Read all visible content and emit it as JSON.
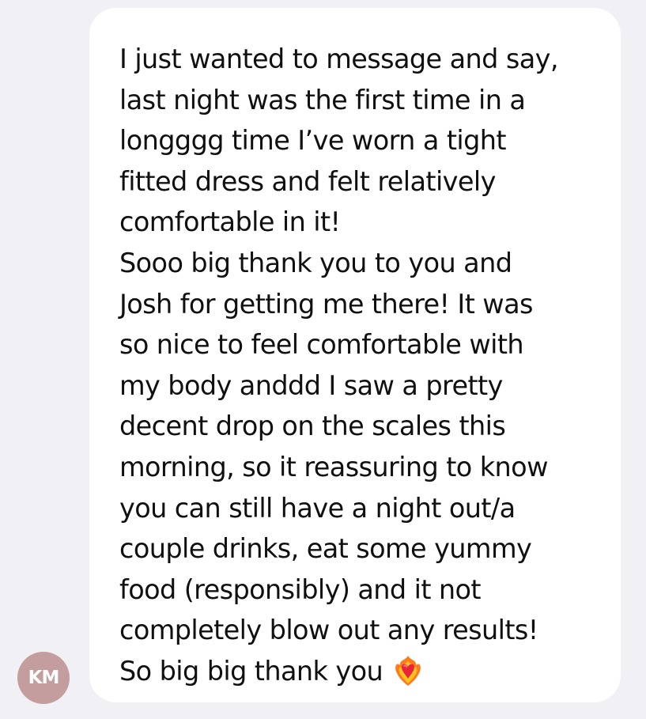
{
  "conversation": {
    "message": {
      "text": "I just wanted to message and say,\nlast night was the first time in a\nlongggg time I’ve worn a tight\nfitted dress and felt relatively\ncomfortable in it!\nSooo big thank you to you and\nJosh for getting me there! It was\nso nice to feel comfortable with\nmy body anddd I saw a pretty\ndecent drop on the scales this\nmorning, so it reassuring to know\nyou can still have a night out/a\ncouple drinks, eat some yummy\nfood (responsibly) and it not\ncompletely blow out any results!\nSo big big thank you",
      "emoji_icon": "heart-on-fire-icon"
    },
    "sender": {
      "initials": "KM",
      "avatar_color": "#c49e9e"
    }
  },
  "colors": {
    "background": "#f1f1f5",
    "bubble": "#ffffff",
    "text": "#101010"
  }
}
